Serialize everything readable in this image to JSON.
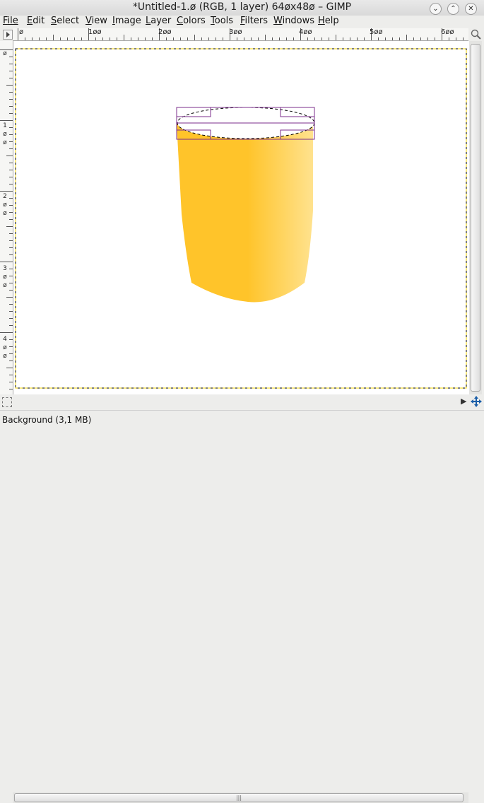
{
  "window": {
    "title": "*Untitled-1.ø (RGB, 1 layer) 64øx48ø – GIMP"
  },
  "menu": [
    {
      "label": "File",
      "name": "menu-file"
    },
    {
      "label": "Edit",
      "name": "menu-edit"
    },
    {
      "label": "Select",
      "name": "menu-select"
    },
    {
      "label": "View",
      "name": "menu-view"
    },
    {
      "label": "Image",
      "name": "menu-image"
    },
    {
      "label": "Layer",
      "name": "menu-layer"
    },
    {
      "label": "Colors",
      "name": "menu-colors"
    },
    {
      "label": "Tools",
      "name": "menu-tools"
    },
    {
      "label": "Filters",
      "name": "menu-filters"
    },
    {
      "label": "Windows",
      "name": "menu-windows"
    },
    {
      "label": "Help",
      "name": "menu-help"
    }
  ],
  "ruler": {
    "horizontal": [
      "ø",
      "1øø",
      "2øø",
      "3øø",
      "4øø",
      "5øø",
      "6øø"
    ],
    "vertical": [
      [
        "ø"
      ],
      [
        "1",
        "ø",
        "ø"
      ],
      [
        "2",
        "ø",
        "ø"
      ],
      [
        "3",
        "ø",
        "ø"
      ],
      [
        "4",
        "ø",
        "ø"
      ]
    ]
  },
  "icons": {
    "menu_arrow": "triangle-right-icon",
    "zoom": "zoom-toggle-icon",
    "quick_mask": "quick-mask-icon",
    "navigate": "navigate-icon",
    "minimize": "chevron-down-icon",
    "maximize": "chevron-up-icon",
    "close": "close-icon"
  },
  "colors": {
    "cup_main": "#ffc42a",
    "cup_highlight": "#ffe28e",
    "selection_box": "#7b2d8b"
  },
  "status": {
    "layer_info": "Background (3,1 MB)"
  }
}
